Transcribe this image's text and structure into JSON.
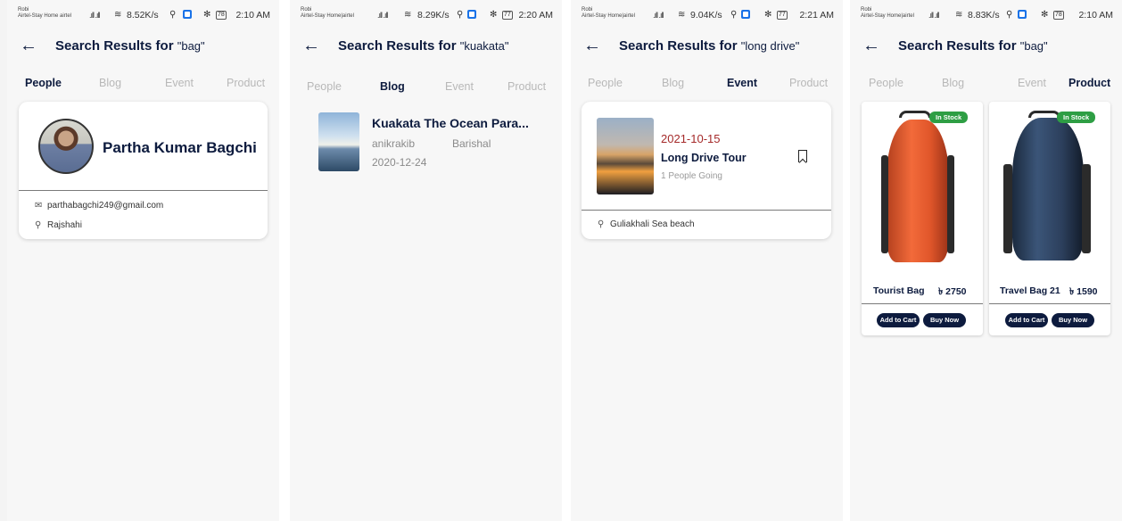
{
  "screens": [
    {
      "status": {
        "carrier_line1": "Robi",
        "carrier_line2": "Airtel-Stay Home airtel",
        "speed": "8.52K/s",
        "battery": "78",
        "time": "2:10 AM"
      },
      "title": "Search Results for",
      "query": "\"bag\"",
      "tabs": [
        "People",
        "Blog",
        "Event",
        "Product"
      ],
      "active_tab": "People",
      "person": {
        "name": "Partha Kumar Bagchi",
        "email": "parthabagchi249@gmail.com",
        "location": "Rajshahi"
      }
    },
    {
      "status": {
        "carrier_line1": "Robi",
        "carrier_line2": "Airtel-Stay Home|airtel",
        "speed": "8.29K/s",
        "battery": "77",
        "time": "2:20 AM"
      },
      "title": "Search Results for",
      "query": "\"kuakata\"",
      "tabs": [
        "People",
        "Blog",
        "Event",
        "Product"
      ],
      "active_tab": "Blog",
      "blog": {
        "title": "Kuakata The Ocean Para...",
        "author": "anikrakib",
        "location": "Barishal",
        "date": "2020-12-24"
      }
    },
    {
      "status": {
        "carrier_line1": "Robi",
        "carrier_line2": "Airtel-Stay Home|airtel",
        "speed": "9.04K/s",
        "battery": "77",
        "time": "2:21 AM"
      },
      "title": "Search Results for",
      "query": "\"long drive\"",
      "tabs": [
        "People",
        "Blog",
        "Event",
        "Product"
      ],
      "active_tab": "Event",
      "event": {
        "date": "2021-10-15",
        "name": "Long Drive Tour",
        "going": "1 People Going",
        "location": "Guliakhali Sea beach"
      }
    },
    {
      "status": {
        "carrier_line1": "Robi",
        "carrier_line2": "Airtel-Stay Home|airtel",
        "speed": "8.83K/s",
        "battery": "78",
        "time": "2:10 AM"
      },
      "title": "Search Results for",
      "query": "\"bag\"",
      "tabs": [
        "People",
        "Blog",
        "Event",
        "Product"
      ],
      "active_tab": "Product",
      "products": [
        {
          "name": "Tourist Bag",
          "price": "৳ 2750",
          "stock": "In Stock",
          "add_to_cart": "Add to Cart",
          "buy_now": "Buy Now"
        },
        {
          "name": "Travel Bag 21",
          "price": "৳ 1590",
          "stock": "In Stock",
          "add_to_cart": "Add to Cart",
          "buy_now": "Buy Now"
        }
      ]
    }
  ],
  "icons": {
    "back": "arrow-left-icon",
    "email": "mail-icon",
    "location": "location-pin-icon",
    "bookmark": "bookmark-icon",
    "wifi": "wifi-icon",
    "signal": "signal-icon",
    "vpn": "vpn-icon",
    "bluetooth": "bluetooth-icon",
    "battery": "battery-icon",
    "usb": "usb-icon"
  },
  "colors": {
    "primary": "#0d1b3e",
    "event_date": "#a52a2a",
    "in_stock": "#2e9e44",
    "inactive_tab": "#b8b8b8"
  }
}
